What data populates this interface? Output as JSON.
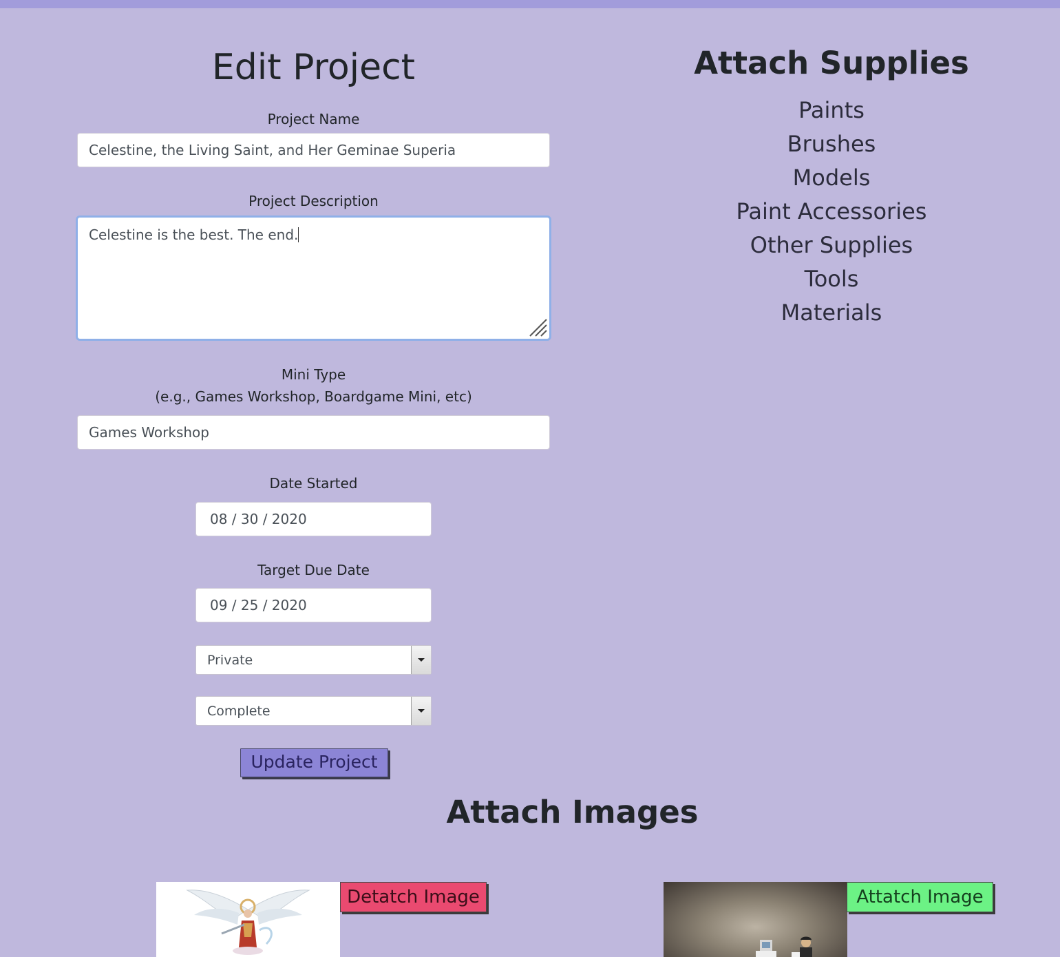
{
  "edit": {
    "title": "Edit Project",
    "name_label": "Project Name",
    "name_value": "Celestine, the Living Saint, and Her Geminae Superia",
    "description_label": "Project Description",
    "description_value": "Celestine is the best. The end.",
    "mini_type_label": "Mini Type",
    "mini_type_hint": "(e.g., Games Workshop, Boardgame Mini, etc)",
    "mini_type_value": "Games Workshop",
    "date_started_label": "Date Started",
    "date_started_value": "08 / 30 / 2020",
    "due_date_label": "Target Due Date",
    "due_date_value": "09 / 25 / 2020",
    "privacy_value": "Private",
    "status_value": "Complete",
    "update_button": "Update Project"
  },
  "supplies": {
    "title": "Attach Supplies",
    "items": [
      "Paints",
      "Brushes",
      "Models",
      "Paint Accessories",
      "Other Supplies",
      "Tools",
      "Materials"
    ]
  },
  "images": {
    "title": "Attach Images",
    "detach_button": "Detatch Image",
    "attach_button": "Attatch Image"
  },
  "colors": {
    "background": "#bfb8dd",
    "topbar": "#a29cdb",
    "update_button": "#8c85d6",
    "detach_button": "#ea4a70",
    "attach_button": "#6cf285"
  }
}
